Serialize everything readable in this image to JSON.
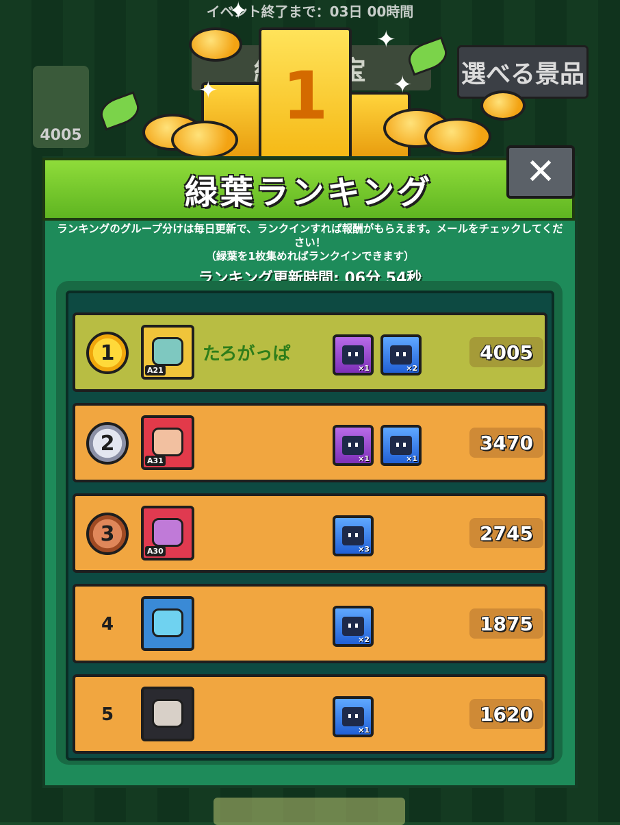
{
  "event_banner": "イベント終了まで：03日 00時間",
  "background": {
    "event_title": "緑の秘宝",
    "prize_button_label": "選べる景品",
    "my_score": "4005"
  },
  "trophy": {
    "place": "1"
  },
  "dialog": {
    "title": "緑葉ランキング",
    "close_glyph": "✕",
    "description_line1": "ランキングのグループ分けは毎日更新で、ランクインすれば報酬がもらえます。メールをチェックしてください！",
    "description_line2": "（緑葉を1枚集めればランクインできます）",
    "timer_text": "ランキング更新時間: 06分 54秒"
  },
  "rankings": [
    {
      "rank": "1",
      "level": "A21",
      "name": "たろがっぱ",
      "rewards": [
        {
          "color": "purple",
          "qty": "×1"
        },
        {
          "color": "blue",
          "qty": "×2"
        }
      ],
      "score": "4005"
    },
    {
      "rank": "2",
      "level": "A31",
      "name": "",
      "rewards": [
        {
          "color": "purple",
          "qty": "×1"
        },
        {
          "color": "blue",
          "qty": "×1"
        }
      ],
      "score": "3470"
    },
    {
      "rank": "3",
      "level": "A30",
      "name": "",
      "rewards": [
        {
          "color": "blue",
          "qty": "×3"
        }
      ],
      "score": "2745"
    },
    {
      "rank": "4",
      "level": "",
      "name": "",
      "rewards": [
        {
          "color": "blue",
          "qty": "×2"
        }
      ],
      "score": "1875"
    },
    {
      "rank": "5",
      "level": "",
      "name": "",
      "rewards": [
        {
          "color": "blue",
          "qty": "×1"
        }
      ],
      "score": "1620"
    }
  ],
  "colors": {
    "header_green": "#72c62c",
    "dialog_green": "#1e8b5a",
    "first_row": "#b8bd43",
    "other_row": "#f1a640",
    "name_green": "#2e7d1a"
  },
  "icons": {
    "close": "close-icon",
    "reward": "treasure-chest-icon",
    "medal": "rank-medal-icon",
    "trophy": "trophy-podium-icon"
  }
}
